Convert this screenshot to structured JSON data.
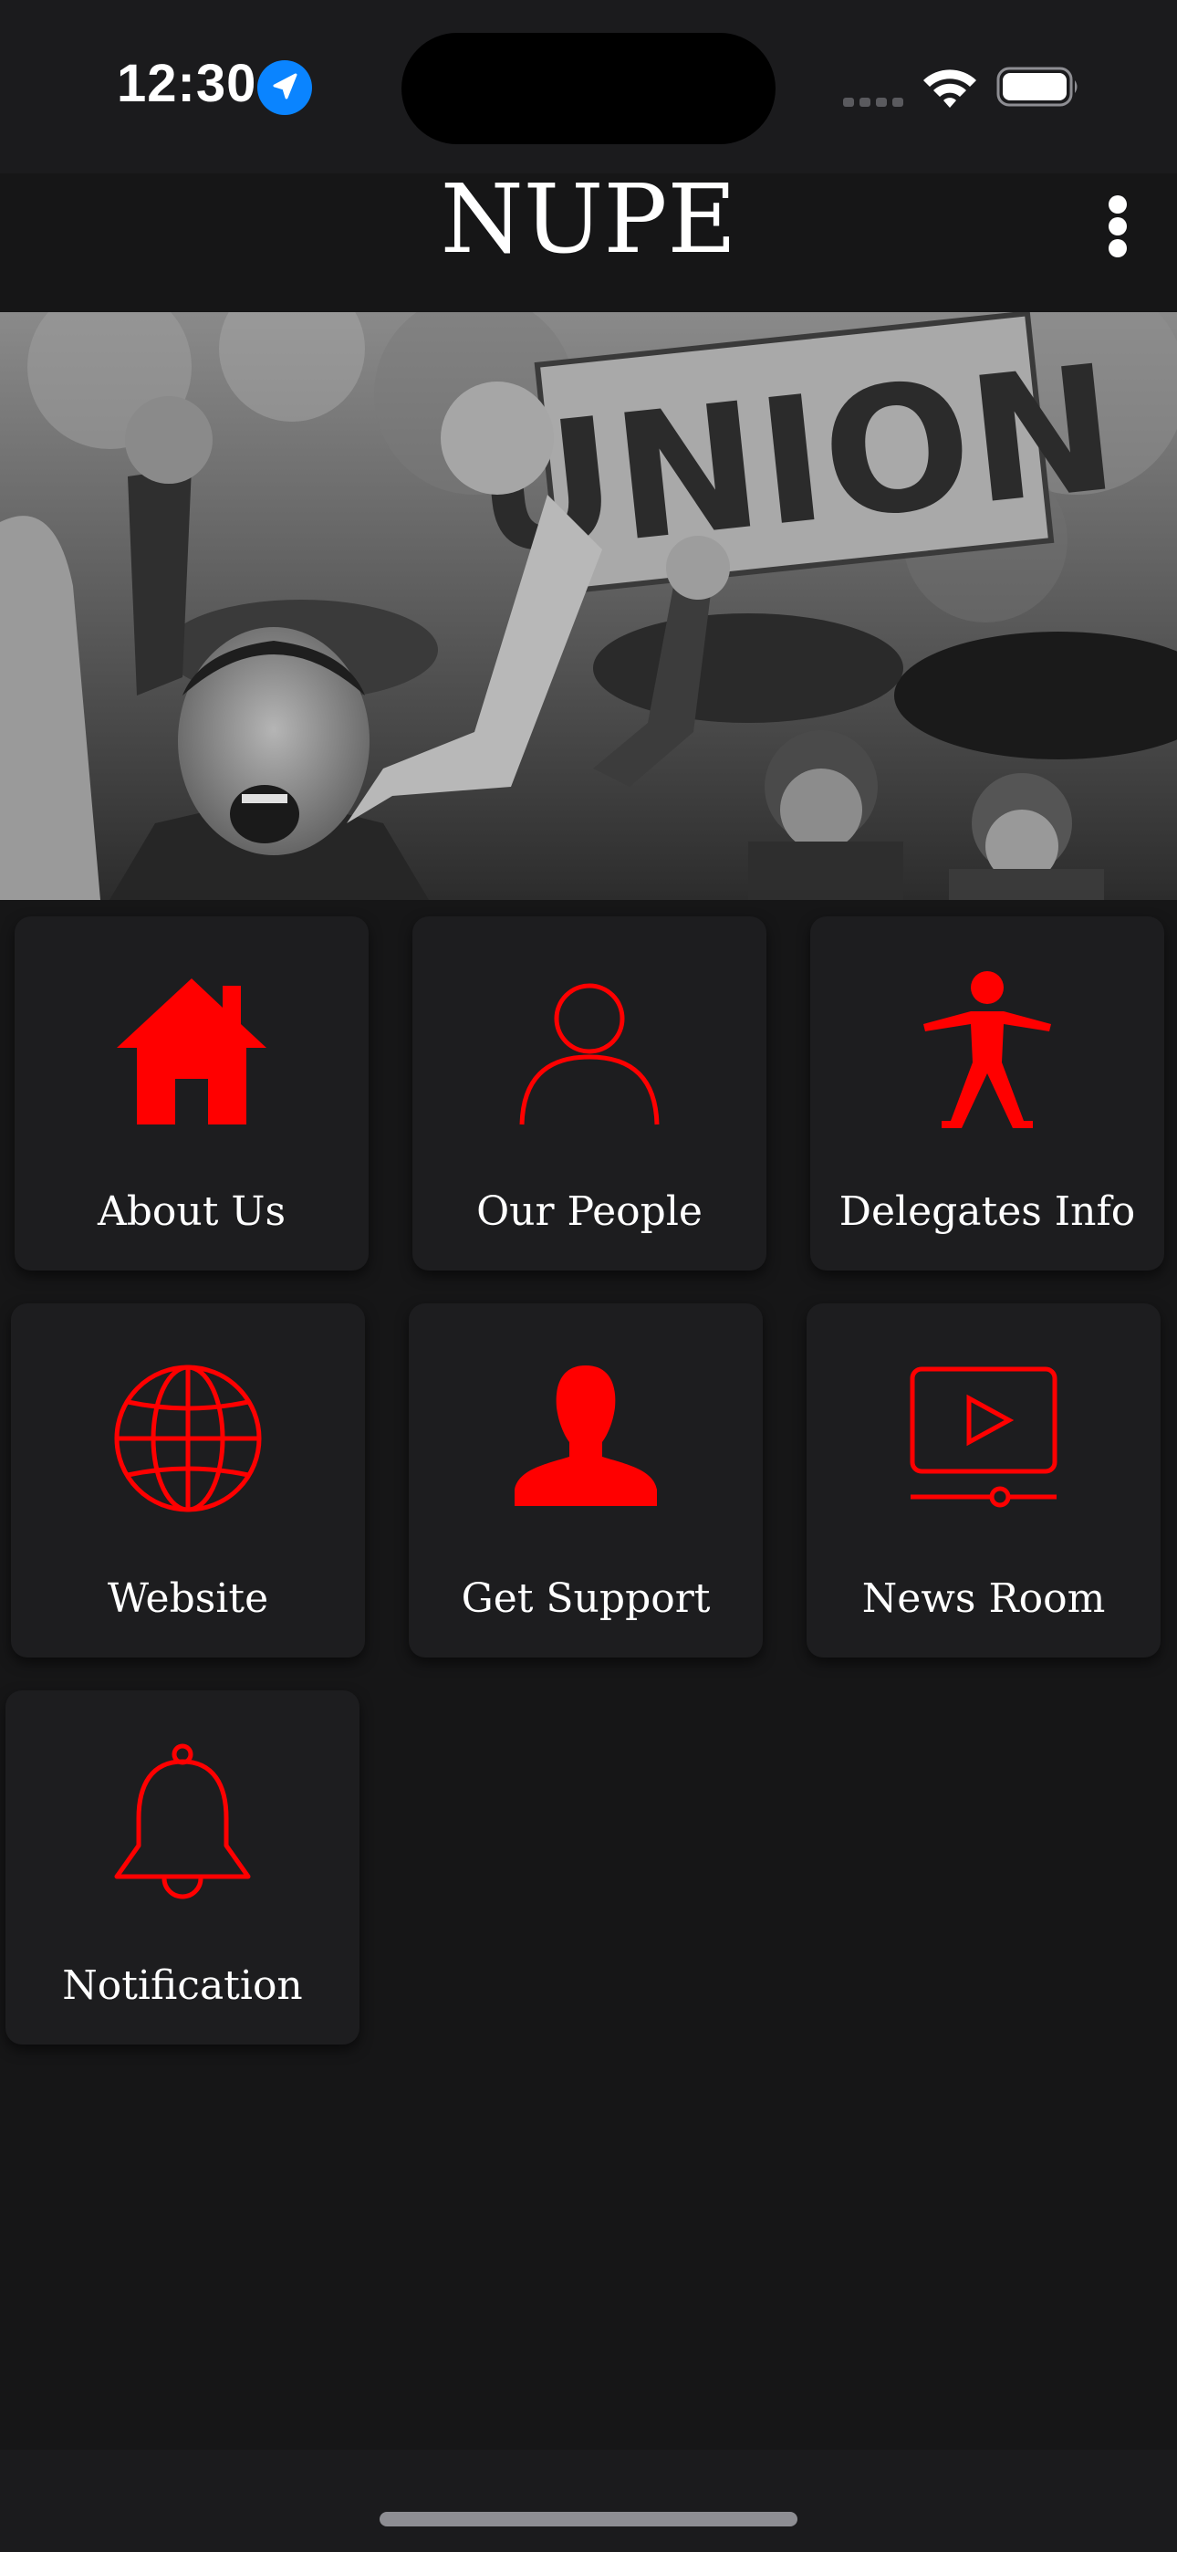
{
  "status_bar": {
    "time": "12:30",
    "location_icon": "location-arrow-icon",
    "signal_icon": "cellular-signal-icon",
    "wifi_icon": "wifi-icon",
    "battery_icon": "battery-icon"
  },
  "header": {
    "title": "NUPE",
    "menu_icon": "more-vertical-icon"
  },
  "hero": {
    "sign_text": "UNION"
  },
  "tiles": [
    {
      "label": "About Us",
      "icon": "home-icon"
    },
    {
      "label": "Our People",
      "icon": "person-outline-icon"
    },
    {
      "label": "Delegates Info",
      "icon": "standing-person-icon"
    },
    {
      "label": "Website",
      "icon": "globe-icon"
    },
    {
      "label": "Get Support",
      "icon": "user-silhouette-icon"
    },
    {
      "label": "News Room",
      "icon": "video-play-icon"
    },
    {
      "label": "Notification",
      "icon": "bell-icon"
    }
  ],
  "colors": {
    "accent": "#ff0000",
    "background": "#161617",
    "tile": "#1d1d1f",
    "bar": "#1b1b1d",
    "location_blue": "#0a84ff"
  }
}
